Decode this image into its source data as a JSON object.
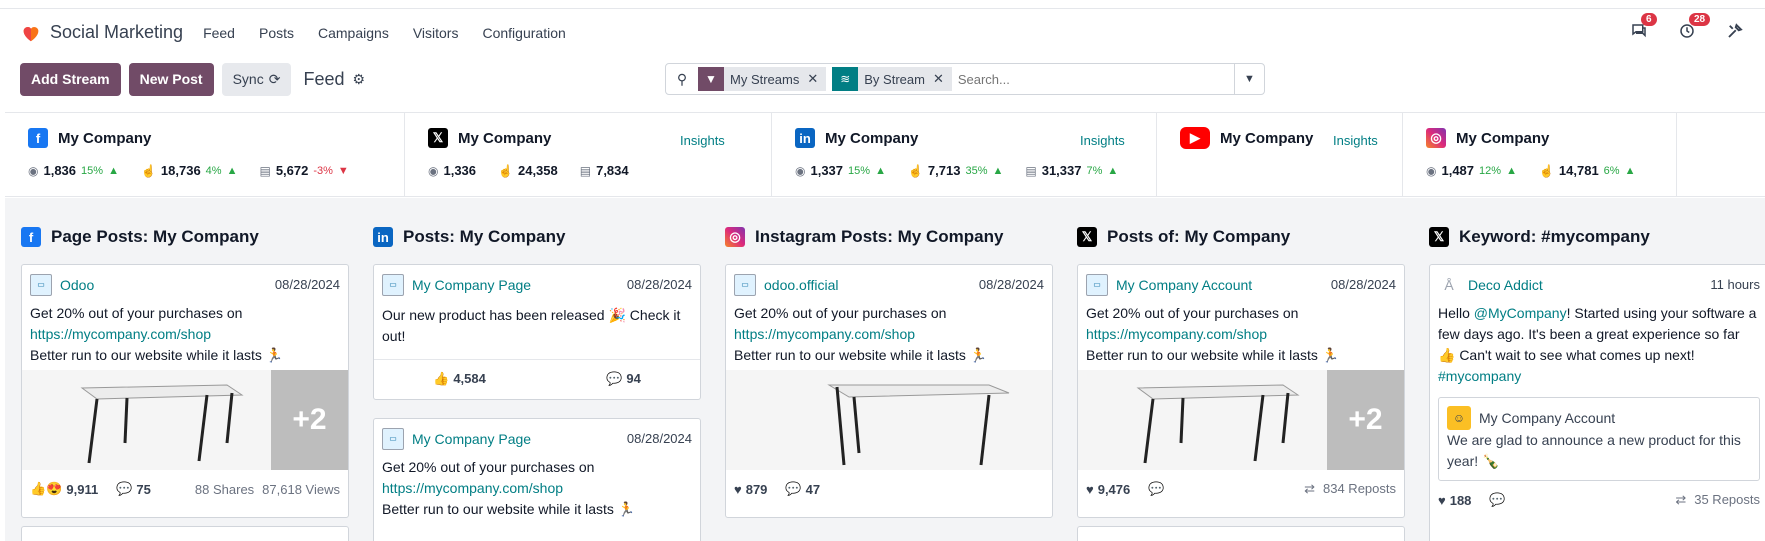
{
  "app": {
    "name": "Social Marketing"
  },
  "menu": [
    "Feed",
    "Posts",
    "Campaigns",
    "Visitors",
    "Configuration"
  ],
  "systray": {
    "messages_badge": "6",
    "activities_badge": "28"
  },
  "control": {
    "add_stream": "Add Stream",
    "new_post": "New Post",
    "sync": "Sync",
    "breadcrumb": "Feed"
  },
  "search": {
    "facets": [
      {
        "label": "My Streams",
        "color": "#714b67",
        "icon": "filter-icon"
      },
      {
        "label": "By Stream",
        "color": "#017e84",
        "icon": "layers-icon"
      }
    ],
    "placeholder": "Search..."
  },
  "accounts": [
    {
      "network": "facebook",
      "name": "My Company",
      "insights": "",
      "stats": [
        {
          "icon": "audience-icon",
          "value": "1,836",
          "trend": "15%",
          "dir": "up"
        },
        {
          "icon": "engagement-icon",
          "value": "18,736",
          "trend": "4%",
          "dir": "up"
        },
        {
          "icon": "stories-icon",
          "value": "5,672",
          "trend": "-3%",
          "dir": "down"
        }
      ]
    },
    {
      "network": "x",
      "name": "My Company",
      "insights": "Insights",
      "stats": [
        {
          "icon": "audience-icon",
          "value": "1,336",
          "trend": "",
          "dir": ""
        },
        {
          "icon": "engagement-icon",
          "value": "24,358",
          "trend": "",
          "dir": ""
        },
        {
          "icon": "stories-icon",
          "value": "7,834",
          "trend": "",
          "dir": ""
        }
      ]
    },
    {
      "network": "linkedin",
      "name": "My Company",
      "insights": "Insights",
      "stats": [
        {
          "icon": "audience-icon",
          "value": "1,337",
          "trend": "15%",
          "dir": "up"
        },
        {
          "icon": "engagement-icon",
          "value": "7,713",
          "trend": "35%",
          "dir": "up"
        },
        {
          "icon": "stories-icon",
          "value": "31,337",
          "trend": "7%",
          "dir": "up"
        }
      ]
    },
    {
      "network": "youtube",
      "name": "My Company",
      "insights": "Insights",
      "stats": []
    },
    {
      "network": "instagram",
      "name": "My Company",
      "insights": "",
      "stats": [
        {
          "icon": "audience-icon",
          "value": "1,487",
          "trend": "12%",
          "dir": "up"
        },
        {
          "icon": "engagement-icon",
          "value": "14,781",
          "trend": "6%",
          "dir": "up"
        }
      ]
    }
  ],
  "streams": [
    {
      "network": "facebook",
      "title": "Page Posts: My Company",
      "post": {
        "author": "Odoo",
        "date": "08/28/2024",
        "text1": "Get 20% out of your purchases on",
        "link": "https://mycompany.com/shop",
        "text2": "Better run to our website while it lasts 🏃",
        "more": "+2",
        "reactions": "9,911",
        "comments": "75",
        "shares": "88 Shares",
        "views": "87,618 Views"
      }
    },
    {
      "network": "linkedin",
      "title": "Posts: My Company",
      "post": {
        "author": "My Company Page",
        "date": "08/28/2024",
        "text1": "Our new product has been released 🎉 Check it out!",
        "likes": "4,584",
        "comments": "94"
      },
      "post2": {
        "author": "My Company Page",
        "date": "08/28/2024",
        "text1": "Get 20% out of your purchases on",
        "link": "https://mycompany.com/shop",
        "text2": "Better run to our website while it lasts 🏃"
      }
    },
    {
      "network": "instagram",
      "title": "Instagram Posts: My Company",
      "post": {
        "author": "odoo.official",
        "date": "08/28/2024",
        "text1": "Get 20% out of your purchases on",
        "link": "https://mycompany.com/shop",
        "text2": "Better run to our website while it lasts 🏃",
        "likes": "879",
        "comments": "47"
      }
    },
    {
      "network": "x",
      "title": "Posts of: My Company",
      "post": {
        "author": "My Company Account",
        "date": "08/28/2024",
        "text1": "Get 20% out of your purchases on",
        "link": "https://mycompany.com/shop",
        "text2": "Better run to our website while it lasts 🏃",
        "more": "+2",
        "likes": "9,476",
        "comments": "",
        "reposts": "834 Reposts"
      }
    },
    {
      "network": "x",
      "title": "Keyword: #mycompany",
      "post": {
        "author": "Deco Addict",
        "date": "11 hours",
        "text_a": "Hello ",
        "mention": "@MyCompany",
        "text_b": "! Started using your software a few days ago. It's been a great experience so far 👍 Can't wait to see what comes up next!",
        "hashtag": "#mycompany",
        "quote_author": "My Company Account",
        "quote_text": "We are glad to announce a new product for this year! 🍾",
        "likes": "188",
        "comments": "",
        "reposts": "35 Reposts"
      }
    }
  ]
}
